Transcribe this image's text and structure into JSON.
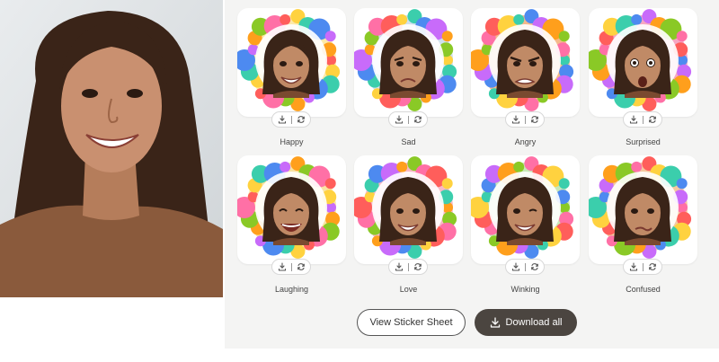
{
  "stickers": [
    {
      "label": "Happy",
      "bg": "#fde9a8",
      "expression": "smile"
    },
    {
      "label": "Sad",
      "bg": "#cfe0ee",
      "expression": "sad"
    },
    {
      "label": "Angry",
      "bg": "#f5b98a",
      "expression": "angry"
    },
    {
      "label": "Surprised",
      "bg": "#f7a6c2",
      "expression": "surprised"
    },
    {
      "label": "Laughing",
      "bg": "#fbe3a1",
      "expression": "laugh"
    },
    {
      "label": "Love",
      "bg": "#f7b9c6",
      "expression": "smile"
    },
    {
      "label": "Winking",
      "bg": "#c8e8b8",
      "expression": "wink"
    },
    {
      "label": "Confused",
      "bg": "#f5c9a0",
      "expression": "confused"
    }
  ],
  "actions": {
    "download_icon": "download-icon",
    "regenerate_icon": "refresh-icon"
  },
  "buttons": {
    "view_sheet": "View Sticker Sheet",
    "download_all": "Download all"
  },
  "colors": {
    "panel": "#f4f4f3",
    "dark_button": "#4b4540",
    "hair": "#3a2418",
    "skin": "#c08a66"
  }
}
